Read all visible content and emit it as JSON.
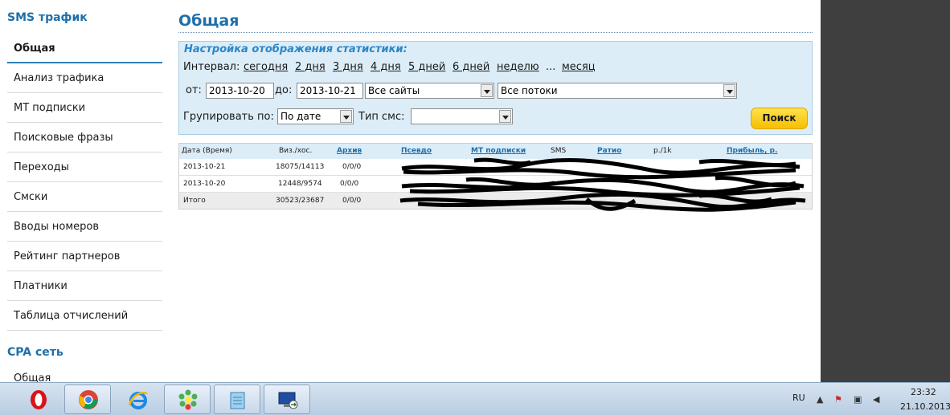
{
  "sidebar": {
    "section1_title": "SMS трафик",
    "items": [
      {
        "label": "Общая"
      },
      {
        "label": "Анализ трафика"
      },
      {
        "label": "МТ подписки"
      },
      {
        "label": "Поисковые фразы"
      },
      {
        "label": "Переходы"
      },
      {
        "label": "Смски"
      },
      {
        "label": "Вводы номеров"
      },
      {
        "label": "Рейтинг партнеров"
      },
      {
        "label": "Платники"
      },
      {
        "label": "Таблица отчислений"
      }
    ],
    "section2_title": "CPA сеть",
    "section2_item": "Общая"
  },
  "main": {
    "title": "Общая",
    "filter_title": "Настройка отображения статистики:",
    "interval_label": "Интервал:",
    "intervals": [
      "сегодня",
      "2 дня",
      "3 дня",
      "4 дня",
      "5 дней",
      "6 дней",
      "неделю"
    ],
    "ellipsis": "...",
    "month_link": "месяц",
    "from_label": "от:",
    "from_value": "2013-10-20",
    "to_label": "до:",
    "to_value": "2013-10-21",
    "sites_select": "Все сайты",
    "streams_select": "Все потоки",
    "group_label": "Групировать по:",
    "group_select": "По дате",
    "sms_type_label": "Тип смс:",
    "sms_type_select": "",
    "search_button": "Поиск"
  },
  "table": {
    "headers": {
      "date": "Дата (Время)",
      "visits": "Виз./хос.",
      "archive": "Архив",
      "pseudo": "Псевдо",
      "mt": "МТ подписки",
      "sms": "SMS",
      "ratio": "Ратио",
      "per1k": "р./1k",
      "profit": "Прибыль, р."
    },
    "rows": [
      {
        "date": "2013-10-21",
        "visits": "18075/14113",
        "archive": "0/0/0"
      },
      {
        "date": "2013-10-20",
        "visits": "12448/9574",
        "archive": "0/0/0"
      }
    ],
    "total": {
      "label": "Итого",
      "visits": "30523/23687",
      "archive": "0/0/0"
    }
  },
  "taskbar": {
    "apps": [
      "opera-icon",
      "chrome-icon",
      "ie-icon",
      "icq-icon",
      "notepad-icon",
      "remote-desktop-icon"
    ],
    "lang": "RU",
    "time": "23:32",
    "date": "21.10.2013"
  },
  "colors": {
    "accent": "#1f6faa",
    "filter_bg": "#dcedf8",
    "button": "#f5c000",
    "side_panel": "#3f3f3f"
  }
}
